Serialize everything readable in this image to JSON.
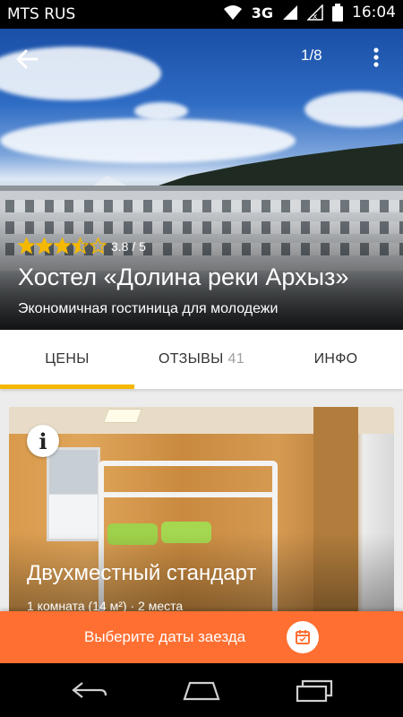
{
  "status_bar": {
    "carrier": "MTS RUS",
    "network": "3G",
    "time": "16:04",
    "icons": [
      "wifi-icon",
      "signal-icon",
      "no-signal-icon",
      "battery-icon"
    ]
  },
  "header": {
    "photo_counter": "1/8",
    "back_icon": "arrow-left-icon",
    "more_icon": "more-vertical-icon"
  },
  "hotel": {
    "rating_value": 3.5,
    "rating_stars_max": 5,
    "rating_text": "3.8 / 5",
    "name": "Хостел «Долина реки Архыз»",
    "description": "Экономичная гостиница для молодежи"
  },
  "tabs": [
    {
      "label": "ЦЕНЫ",
      "count": "",
      "selected": true
    },
    {
      "label": "ОТЗЫВЫ",
      "count": "41",
      "selected": false
    },
    {
      "label": "ИНФО",
      "count": "",
      "selected": false
    }
  ],
  "room": {
    "info_icon": "info-icon",
    "info_glyph": "i",
    "name": "Двухместный стандарт",
    "details": "1 комната (14 м²) · 2 места"
  },
  "cta": {
    "label": "Выберите даты заезда",
    "icon": "calendar-icon"
  },
  "nav_bar": {
    "buttons": [
      "back-icon",
      "home-icon",
      "recent-apps-icon"
    ]
  },
  "colors": {
    "accent": "#ff6f31",
    "tab_indicator": "#f5b800",
    "star": "#f5b800"
  }
}
